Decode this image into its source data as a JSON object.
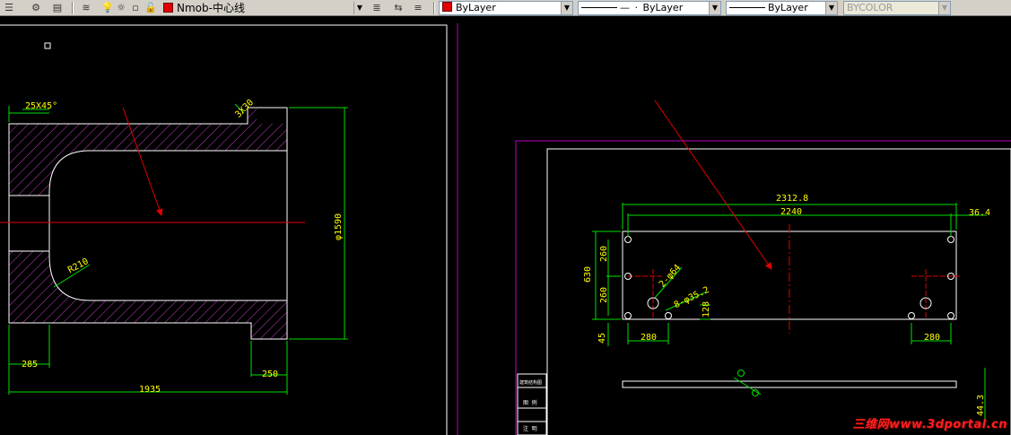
{
  "toolbar": {
    "layer_name": "Nmob-中心线",
    "color_value": "ByLayer",
    "linetype_value": "ByLayer",
    "lineweight_value": "ByLayer",
    "plotstyle_value": "BYCOLOR",
    "layer_swatch_color": "#e00000"
  },
  "left_view": {
    "chamfer_label": "25X45°",
    "angle_label": "3X30",
    "radius_label": "R210",
    "diameter_label": "φ1590",
    "dim_285": "285",
    "dim_250": "250",
    "dim_1935": "1935"
  },
  "right_view": {
    "overall_length": "2312.8",
    "hole_spacing": "2240",
    "offset_right": "36.4",
    "height_total": "630",
    "height_upper": "260",
    "height_lower": "260",
    "edge_bottom": "45",
    "hole_dia_a": "2-φ64",
    "hole_dia_b": "8-φ35.2",
    "dim_128": "128",
    "dim_280_left": "280",
    "dim_280_right": "280",
    "dim_44_3": "44.3",
    "phi_mark": "φ"
  },
  "title_block": {
    "row1": "建筑结构图",
    "row2": "图 例",
    "row3": "注 明"
  },
  "watermark": "三维网www.3dportal.cn"
}
